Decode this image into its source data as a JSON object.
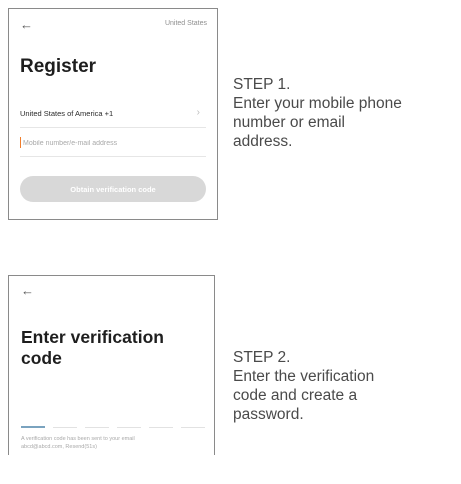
{
  "register_screen": {
    "back_icon": "arrow-left-icon",
    "country_top": "United States",
    "title": "Register",
    "country_code_label": "United States of America +1",
    "chevron_icon": "chevron-right-icon",
    "mobile_placeholder": "Mobile number/e-mail address",
    "obtain_button": "Obtain verification code"
  },
  "verify_screen": {
    "back_icon": "arrow-left-icon",
    "title_line1": "Enter verification",
    "title_line2": "code",
    "hint_line1": "A verification code has been sent to your email",
    "hint_line2": "abcd@abcd.com, Resend(51s)"
  },
  "steps": [
    {
      "label": "STEP 1.",
      "text_lines": [
        "Enter your mobile phone",
        "number or email",
        "address."
      ]
    },
    {
      "label": "STEP 2.",
      "text_lines": [
        "Enter the verification",
        "code and create a",
        "password."
      ]
    }
  ],
  "colors": {
    "button_disabled": "#d8d8d8",
    "caret": "#f07d2b",
    "active_slot": "#7aa3bf"
  }
}
